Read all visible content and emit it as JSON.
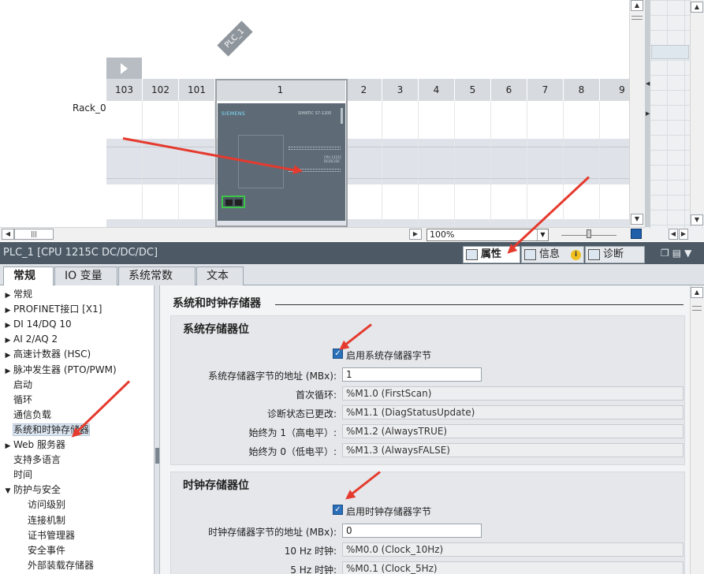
{
  "device_view": {
    "plc_tag": "PLC_1",
    "rack_label": "Rack_0",
    "slots": [
      "103",
      "102",
      "101",
      "1",
      "2",
      "3",
      "4",
      "5",
      "6",
      "7",
      "8",
      "9"
    ],
    "cpu_brand": "SIEMENS",
    "cpu_model_text": "SIMATIC S7-1200",
    "cpu_id_text": "CPU 1215C DC/DC/DC",
    "zoom": "100%"
  },
  "inspector": {
    "title": "PLC_1 [CPU 1215C DC/DC/DC]",
    "tabs": [
      {
        "label": "属性",
        "icon": "properties-icon"
      },
      {
        "label": "信息",
        "icon": "info-icon"
      },
      {
        "label": "诊断",
        "icon": "diagnostics-icon"
      }
    ],
    "general_tabs": [
      "常规",
      "IO 变量",
      "系统常数",
      "文本"
    ]
  },
  "nav": {
    "items": [
      {
        "label": "常规",
        "arrow": "▶",
        "indent": 0
      },
      {
        "label": "PROFINET接口 [X1]",
        "arrow": "▶",
        "indent": 0
      },
      {
        "label": "DI 14/DQ 10",
        "arrow": "▶",
        "indent": 0
      },
      {
        "label": "AI 2/AQ 2",
        "arrow": "▶",
        "indent": 0
      },
      {
        "label": "高速计数器 (HSC)",
        "arrow": "▶",
        "indent": 0
      },
      {
        "label": "脉冲发生器 (PTO/PWM)",
        "arrow": "▶",
        "indent": 0
      },
      {
        "label": "启动",
        "arrow": "",
        "indent": 0
      },
      {
        "label": "循环",
        "arrow": "",
        "indent": 0
      },
      {
        "label": "通信负载",
        "arrow": "",
        "indent": 0
      },
      {
        "label": "系统和时钟存储器",
        "arrow": "",
        "indent": 0,
        "selected": true
      },
      {
        "label": "Web 服务器",
        "arrow": "▶",
        "indent": 0
      },
      {
        "label": "支持多语言",
        "arrow": "",
        "indent": 0
      },
      {
        "label": "时间",
        "arrow": "",
        "indent": 0
      },
      {
        "label": "防护与安全",
        "arrow": "▼",
        "indent": 0
      },
      {
        "label": "访问级别",
        "arrow": "",
        "indent": 1
      },
      {
        "label": "连接机制",
        "arrow": "",
        "indent": 1
      },
      {
        "label": "证书管理器",
        "arrow": "",
        "indent": 1
      },
      {
        "label": "安全事件",
        "arrow": "",
        "indent": 1
      },
      {
        "label": "外部装载存储器",
        "arrow": "",
        "indent": 1
      }
    ]
  },
  "content": {
    "section_title": "系统和时钟存储器",
    "system_memory": {
      "title": "系统存储器位",
      "enable_label": "启用系统存储器字节",
      "enabled": true,
      "address_label": "系统存储器字节的地址 (MBx):",
      "address_value": "1",
      "rows": [
        {
          "label": "首次循环:",
          "value": "%M1.0 (FirstScan)"
        },
        {
          "label": "诊断状态已更改:",
          "value": "%M1.1 (DiagStatusUpdate)"
        },
        {
          "label": "始终为 1（高电平）:",
          "value": "%M1.2 (AlwaysTRUE)"
        },
        {
          "label": "始终为 0（低电平）:",
          "value": "%M1.3 (AlwaysFALSE)"
        }
      ]
    },
    "clock_memory": {
      "title": "时钟存储器位",
      "enable_label": "启用时钟存储器字节",
      "enabled": true,
      "address_label": "时钟存储器字节的地址 (MBx):",
      "address_value": "0",
      "rows": [
        {
          "label": "10 Hz 时钟:",
          "value": "%M0.0 (Clock_10Hz)"
        },
        {
          "label": "5 Hz 时钟:",
          "value": "%M0.1 (Clock_5Hz)"
        }
      ]
    }
  },
  "colors": {
    "annotation_arrow": "#e53a2e",
    "title_bar": "#4d5a66",
    "checkbox": "#2b6fb8",
    "port_highlight": "#3fc44a"
  }
}
